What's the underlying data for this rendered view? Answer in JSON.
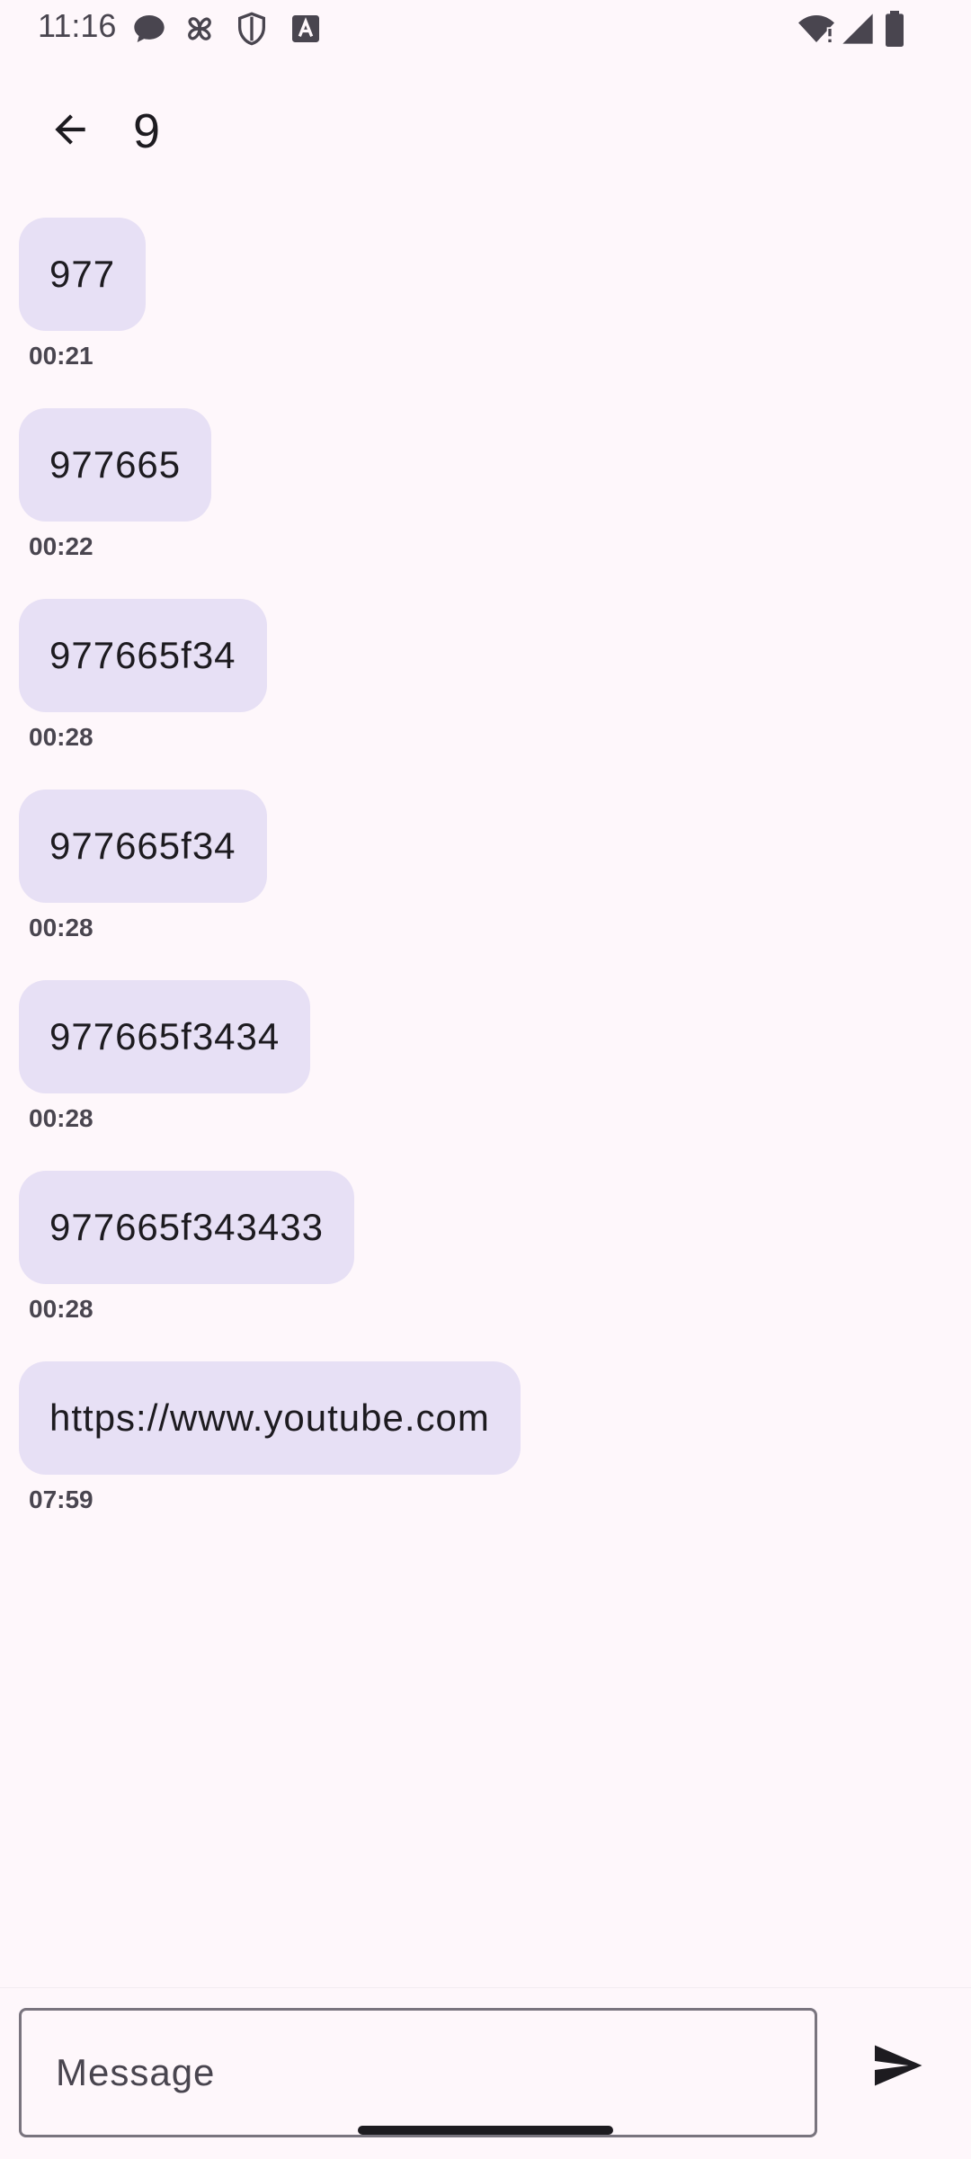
{
  "status_bar": {
    "time": "11:16",
    "icons_left": [
      "chat-bubble-icon",
      "pinwheel-icon",
      "shield-icon",
      "text-a-icon"
    ],
    "icons_right": [
      "wifi-alert-icon",
      "signal-icon",
      "battery-icon"
    ]
  },
  "app_bar": {
    "back_icon": "arrow-back-icon",
    "title": "9"
  },
  "messages": [
    {
      "text": "977",
      "time": "00:21"
    },
    {
      "text": "977665",
      "time": "00:22"
    },
    {
      "text": "977665f34",
      "time": "00:28"
    },
    {
      "text": "977665f34",
      "time": "00:28"
    },
    {
      "text": "977665f3434",
      "time": "00:28"
    },
    {
      "text": "977665f343433",
      "time": "00:28"
    },
    {
      "text": "https://www.youtube.com",
      "time": "07:59"
    }
  ],
  "composer": {
    "placeholder": "Message",
    "value": "",
    "send_icon": "send-icon"
  },
  "colors": {
    "background": "#FEF7FB",
    "bubble": "#E7E0F5",
    "text": "#1D1B20",
    "secondary_text": "#49454F",
    "outline": "#79747E"
  }
}
